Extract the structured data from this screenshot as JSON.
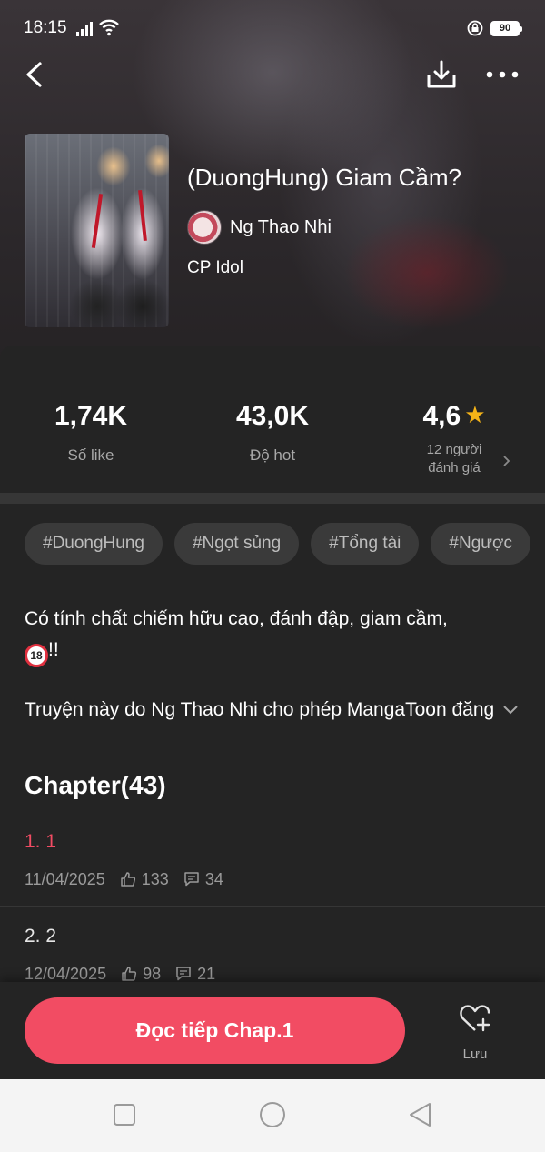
{
  "status_bar": {
    "time": "18:15",
    "battery": "90"
  },
  "comic": {
    "title": "(DuongHung) Giam Cầm?",
    "author": "Ng Thao Nhi",
    "category": "CP Idol"
  },
  "stats": {
    "likes": {
      "value": "1,74K",
      "label": "Số like"
    },
    "hot": {
      "value": "43,0K",
      "label": "Độ hot"
    },
    "rating": {
      "value": "4,6",
      "label_line1": "12 người",
      "label_line2": "đánh giá"
    }
  },
  "tags": [
    "#DuongHung",
    "#Ngọt sủng",
    "#Tổng tài",
    "#Ngược"
  ],
  "description": {
    "text": "Có tính chất chiếm hữu cao, đánh đập, giam cầm,",
    "badge": "18",
    "suffix": "!!"
  },
  "permission_text": "Truyện này do Ng Thao Nhi cho phép MangaToon đăng tải",
  "chapter_heading": "Chapter(43)",
  "chapters": [
    {
      "title": "1. 1",
      "date": "11/04/2025",
      "likes": "133",
      "comments": "34",
      "color": "#f24c63"
    },
    {
      "title": "2. 2",
      "date": "12/04/2025",
      "likes": "98",
      "comments": "21",
      "color": "#e6e6e6"
    }
  ],
  "actions": {
    "read_label": "Đọc tiếp Chap.1",
    "save_label": "Lưu"
  },
  "colors": {
    "accent": "#f24c63",
    "star": "#f5b418",
    "background": "#242424"
  }
}
